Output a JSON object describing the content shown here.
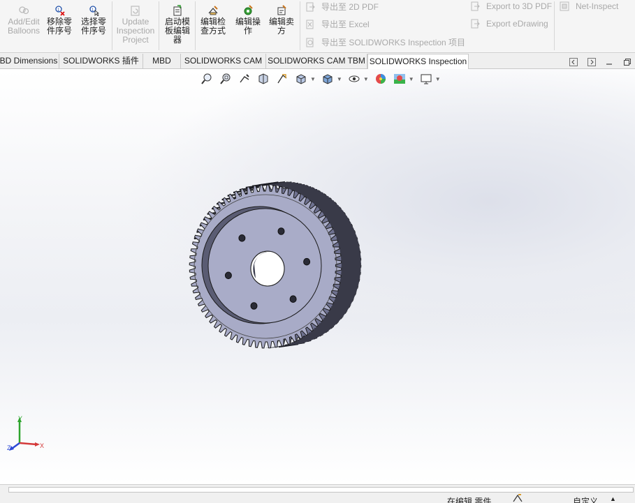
{
  "ribbon": {
    "buttons": [
      {
        "label": "Add/Edit\nBalloons",
        "icon": "balloon-icon",
        "enabled": false
      },
      {
        "label": "移除零\n件序号",
        "icon": "remove-balloon-icon",
        "enabled": true
      },
      {
        "label": "选择零\n件序号",
        "icon": "select-balloon-icon",
        "enabled": true
      },
      {
        "label": "Update\nInspection\nProject",
        "icon": "update-project-icon",
        "enabled": false
      },
      {
        "label": "启动模\n板编辑\n器",
        "icon": "template-editor-icon",
        "enabled": true
      },
      {
        "label": "编辑检\n查方式",
        "icon": "edit-inspection-method-icon",
        "enabled": true
      },
      {
        "label": "编辑操\n作",
        "icon": "edit-operation-icon",
        "enabled": true
      },
      {
        "label": "编辑卖\n方",
        "icon": "edit-vendor-icon",
        "enabled": true
      }
    ],
    "export_items": [
      {
        "label": "导出至 2D PDF",
        "icon": "export-2d-pdf-icon"
      },
      {
        "label": "导出至 Excel",
        "icon": "export-excel-icon"
      },
      {
        "label": "导出至 SOLIDWORKS Inspection 项目",
        "icon": "export-inspection-project-icon"
      }
    ],
    "export_items_right": [
      {
        "label": "Export to 3D PDF",
        "icon": "export-3d-pdf-icon"
      },
      {
        "label": "Export eDrawing",
        "icon": "export-edrawing-icon"
      }
    ],
    "net_inspect": {
      "label": "Net-Inspect",
      "icon": "net-inspect-icon"
    }
  },
  "tabs": [
    {
      "label": "BD Dimensions",
      "active": false
    },
    {
      "label": "SOLIDWORKS 插件",
      "active": false
    },
    {
      "label": "MBD",
      "active": false
    },
    {
      "label": "SOLIDWORKS CAM",
      "active": false
    },
    {
      "label": "SOLIDWORKS CAM TBM",
      "active": false
    },
    {
      "label": "SOLIDWORKS Inspection",
      "active": true
    }
  ],
  "heads_up_toolbar": [
    "zoom-to-fit-icon",
    "zoom-to-area-icon",
    "previous-view-icon",
    "section-view-icon",
    "dynamic-annotation-icon",
    "view-orientation-icon",
    "display-style-icon",
    "hide-show-items-icon",
    "edit-appearance-icon",
    "apply-scene-icon",
    "view-settings-icon"
  ],
  "triad": {
    "x_label": "X",
    "y_label": "Y",
    "z_label": "Z"
  },
  "status_bar": {
    "mode": "在编辑 零件",
    "units": "自定义",
    "units_caret": "▲"
  },
  "colors": {
    "part_fill": "#a8abc7",
    "part_light": "#c4c6dc",
    "part_dark": "#6f7290",
    "edge": "#1a1a1a",
    "accent_tab": "#ffffff"
  }
}
